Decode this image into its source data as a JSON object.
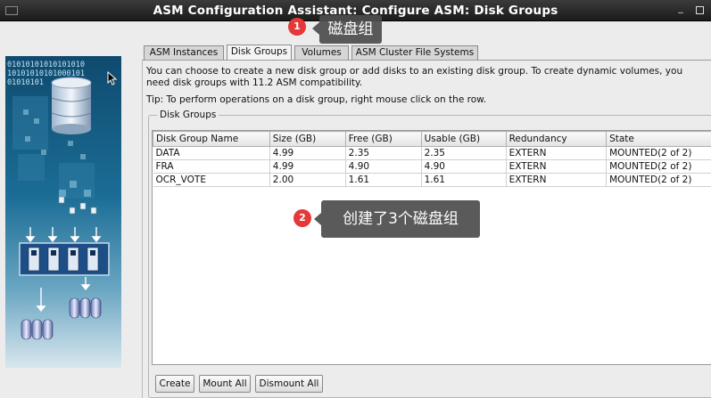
{
  "window": {
    "title": "ASM Configuration Assistant: Configure ASM: Disk Groups"
  },
  "tabs": [
    "ASM Instances",
    "Disk Groups",
    "Volumes",
    "ASM Cluster File Systems"
  ],
  "active_tab": "Disk Groups",
  "description": "You can choose to create a new disk group or add disks to an existing disk group. To create dynamic volumes, you need disk groups with 11.2 ASM compatibility.",
  "tip": "Tip: To perform operations on a disk group, right mouse click on the row.",
  "groupbox_label": "Disk Groups",
  "table": {
    "headers": [
      "Disk Group Name",
      "Size (GB)",
      "Free (GB)",
      "Usable (GB)",
      "Redundancy",
      "State"
    ],
    "rows": [
      [
        "DATA",
        "4.99",
        "2.35",
        "2.35",
        "EXTERN",
        "MOUNTED(2 of 2)"
      ],
      [
        "FRA",
        "4.99",
        "4.90",
        "4.90",
        "EXTERN",
        "MOUNTED(2 of 2)"
      ],
      [
        "OCR_VOTE",
        "2.00",
        "1.61",
        "1.61",
        "EXTERN",
        "MOUNTED(2 of 2)"
      ]
    ]
  },
  "buttons": {
    "create": "Create",
    "mount_all": "Mount All",
    "dismount_all": "Dismount All"
  },
  "side_image": {
    "binary_lines": [
      "01010101010101010",
      "10101010101000101",
      "01010101"
    ]
  },
  "annotations": [
    {
      "number": "1",
      "text": "磁盘组"
    },
    {
      "number": "2",
      "text": "创建了3个磁盘组"
    }
  ],
  "colors": {
    "badge": "#e53838",
    "callout": "#4e4e4e",
    "titlebar": "#2a2a2a"
  }
}
